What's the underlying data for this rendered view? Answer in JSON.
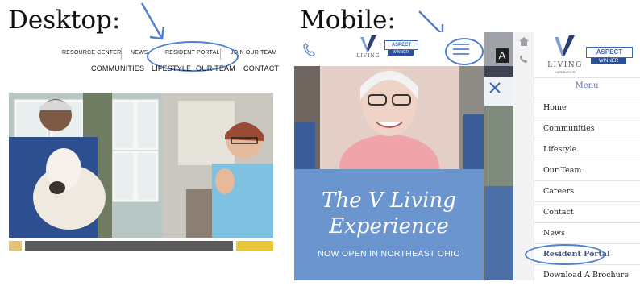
{
  "labels": {
    "desktop": "Desktop:",
    "mobile": "Mobile:"
  },
  "desktop": {
    "top_nav": [
      "RESOURCE CENTER",
      "NEWS",
      "RESIDENT PORTAL",
      "JOIN OUR TEAM"
    ],
    "main_nav": [
      "COMMUNITIES",
      "LIFESTYLE",
      "OUR TEAM",
      "CONTACT"
    ]
  },
  "mobile": {
    "logo_text": "LIVING",
    "logo_sub": "EXPERIENCE",
    "award_title": "ASPECT",
    "award_sub": "WINNER",
    "banner_line1": "The V Living",
    "banner_line2": "Experience",
    "banner_sub": "NOW OPEN IN NORTHEAST OHIO",
    "gray_letter": "A"
  },
  "menu": {
    "logo_text": "LIVING",
    "logo_sub": "EXPERIENCE",
    "award_title": "ASPECT",
    "award_sub": "WINNER",
    "title": "Menu",
    "items": [
      "Home",
      "Communities",
      "Lifestyle",
      "Our Team",
      "Careers",
      "Contact",
      "News",
      "Resident Portal",
      "Download A Brochure"
    ]
  },
  "colors": {
    "accent": "#4f7fcf",
    "banner": "#6b95cf",
    "menu_title": "#5a74b5",
    "highlight": "#44578d"
  }
}
